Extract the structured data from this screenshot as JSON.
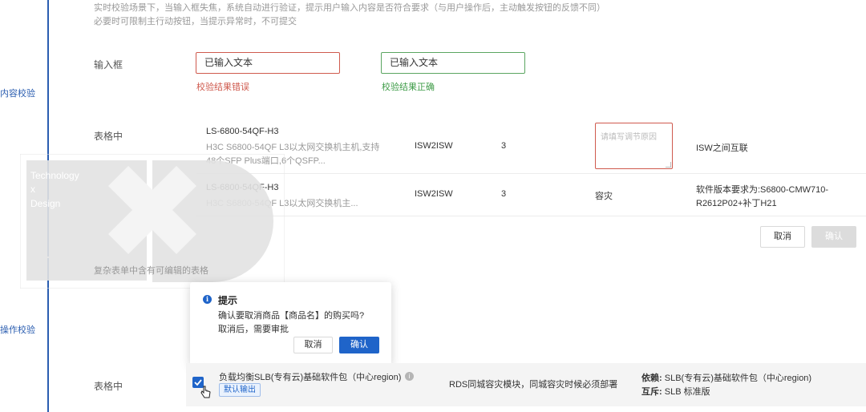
{
  "sections": {
    "content_check": "内容校验",
    "action_check": "操作校验"
  },
  "content_validation": {
    "desc_line1": "实时校验场景下，当输入框失焦，系统自动进行验证，提示用户输入内容是否符合要求（与用户操作后，主动触发按钮的反馈不同）",
    "desc_line2": "必要时可限制主行动按钮，当提示异常时，不可提交",
    "input_row_label": "输入框",
    "input_error_value": "已输入文本",
    "input_error_hint": "校验结果错误",
    "input_ok_value": "已输入文本",
    "input_ok_hint": "校验结果正确",
    "table_row_label": "表格中",
    "table_rows": [
      {
        "model": "LS-6800-54QF-H3",
        "desc_line1": "H3C S6800-54QF L3以太网交换机主机,支持",
        "desc_line2": "48个SFP Plus端口,6个QSFP...",
        "type": "ISW2ISW",
        "qty": "3",
        "field_placeholder": "请填写调节原因",
        "remark": "ISW之间互联"
      },
      {
        "model": "LS-6800-54QF-H3",
        "desc_line1": "H3C S6800-54QF L3以太网交换机主...",
        "type": "ISW2ISW",
        "qty": "3",
        "field_value": "容灾",
        "remark_line1": "软件版本要求为:S6800-CMW710-",
        "remark_line2": "R2612P02+补丁H21"
      }
    ],
    "cancel_label": "取消",
    "confirm_label": "确认",
    "complex_table_caption": "复杂表单中含有可编辑的表格"
  },
  "watermark": {
    "line1": "Technology",
    "line2": "x",
    "line3": "Design"
  },
  "popover": {
    "icon": "info-icon",
    "title": "提示",
    "line1": "确认要取消商品【商品名】的购买吗?",
    "line2": "取消后，需要审批",
    "cancel_label": "取消",
    "confirm_label": "确认"
  },
  "action_table": {
    "row_label": "表格中",
    "product_name": "负载均衡SLB(专有云)基础软件包（中心region)",
    "tag": "默认输出",
    "note": "RDS同城容灾模块，同城容灾时候必须部署",
    "depends_label": "依赖:",
    "depends_value": "SLB(专有云)基础软件包（中心region)",
    "conflict_label": "互斥:",
    "conflict_value": "SLB 标准版",
    "checked": true
  },
  "colors": {
    "accent": "#1f64c9",
    "error": "#cf5a4e",
    "success": "#3f9c48",
    "section_line": "#2a5db0"
  }
}
